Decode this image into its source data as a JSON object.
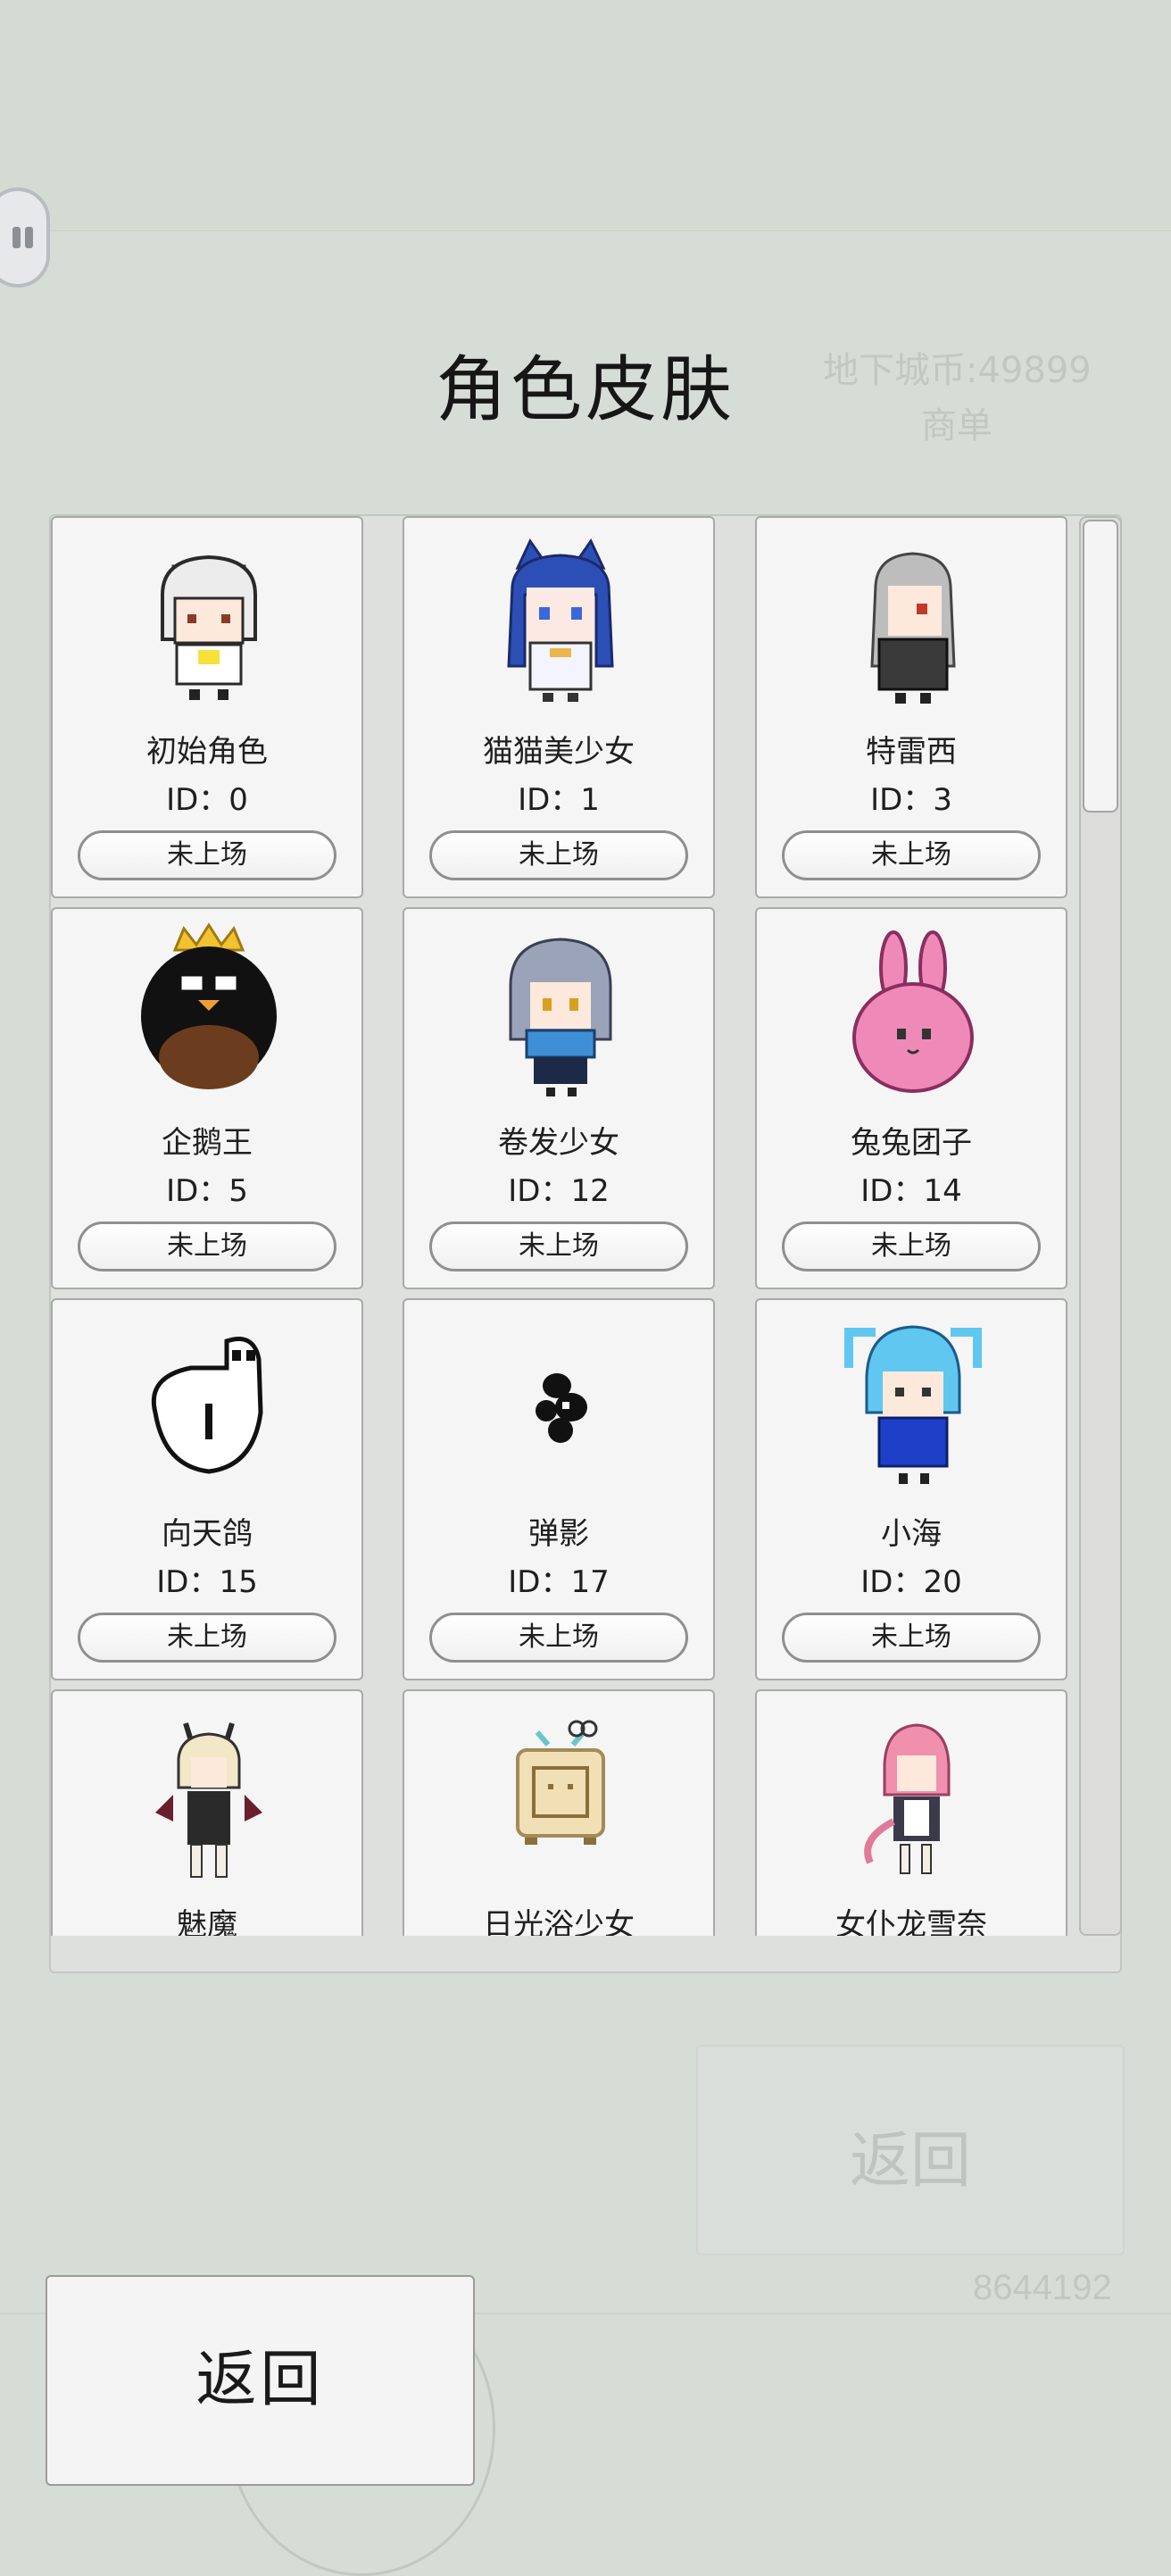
{
  "background": {
    "currency_text": "地下城币:49899",
    "menu_text": "商单",
    "return_label": "返回",
    "number_text": "8644192"
  },
  "title": "角色皮肤",
  "status_label": "未上场",
  "id_prefix": "ID：",
  "characters": [
    {
      "name": "初始角色",
      "id": 0,
      "icon": "white-hair-chibi-icon",
      "accent": "#f5e13a"
    },
    {
      "name": "猫猫美少女",
      "id": 1,
      "icon": "cat-girl-icon",
      "accent": "#2b4fb5"
    },
    {
      "name": "特雷西",
      "id": 3,
      "icon": "grey-hair-girl-icon",
      "accent": "#3a3a3a"
    },
    {
      "name": "企鹅王",
      "id": 5,
      "icon": "penguin-king-icon",
      "accent": "#f2c230"
    },
    {
      "name": "卷发少女",
      "id": 12,
      "icon": "curly-hair-girl-icon",
      "accent": "#3f8fd6"
    },
    {
      "name": "兔兔团子",
      "id": 14,
      "icon": "bunny-dumpling-icon",
      "accent": "#ef8ab8"
    },
    {
      "name": "向天鸽",
      "id": 15,
      "icon": "pigeon-icon",
      "accent": "#ffffff"
    },
    {
      "name": "弹影",
      "id": 17,
      "icon": "shadow-blob-icon",
      "accent": "#111111"
    },
    {
      "name": "小海",
      "id": 20,
      "icon": "sea-boy-icon",
      "accent": "#5fc7f0"
    },
    {
      "name": "魅魔",
      "id": "",
      "icon": "succubus-icon",
      "accent": "#2a2a2a"
    },
    {
      "name": "日光浴少女",
      "id": "",
      "icon": "tv-box-icon",
      "accent": "#f1dfb6"
    },
    {
      "name": "女仆龙雪奈",
      "id": "",
      "icon": "maid-dragon-icon",
      "accent": "#f08fae"
    }
  ],
  "return_button": "返回"
}
